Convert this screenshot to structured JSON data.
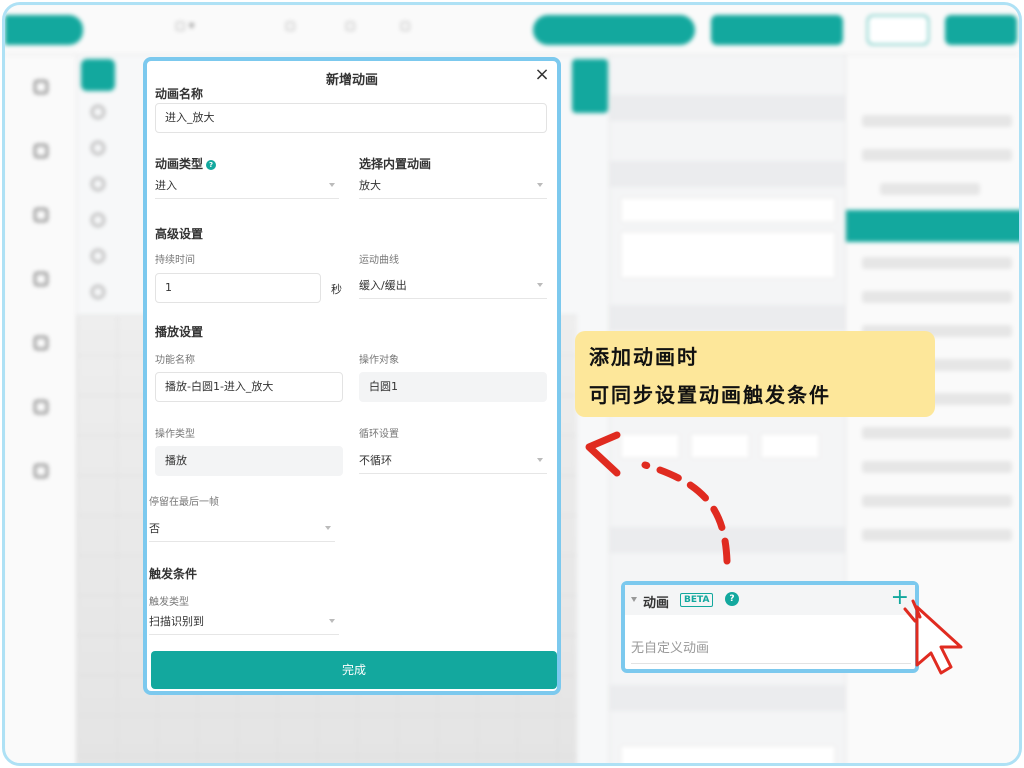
{
  "modal": {
    "title": "新增动画",
    "close_glyph": "×",
    "name_label": "动画名称",
    "name_value": "进入_放大",
    "type_label": "动画类型",
    "type_help": "?",
    "type_value": "进入",
    "builtin_label": "选择内置动画",
    "builtin_value": "放大",
    "advanced_label": "高级设置",
    "duration_label": "持续时间",
    "duration_value": "1",
    "duration_unit": "秒",
    "curve_label": "运动曲线",
    "curve_value": "缓入/缓出",
    "playback_label": "播放设置",
    "func_name_label": "功能名称",
    "func_name_value": "播放-白圆1-进入_放大",
    "target_label": "操作对象",
    "target_value": "白圆1",
    "op_type_label": "操作类型",
    "op_type_value": "播放",
    "loop_label": "循环设置",
    "loop_value": "不循环",
    "stay_label": "停留在最后一帧",
    "stay_value": "否",
    "trigger_label": "触发条件",
    "trigger_type_label": "触发类型",
    "trigger_type_value": "扫描识别到",
    "done_label": "完成"
  },
  "callout": {
    "line1": "添加动画时",
    "line2": "可同步设置动画触发条件"
  },
  "animation_card": {
    "title": "动画",
    "badge": "BETA",
    "help": "?",
    "add_glyph": "+",
    "empty_text": "无自定义动画"
  },
  "colors": {
    "accent": "#13a89e",
    "highlight_border": "#7cc9ee",
    "callout_bg": "#fde79a",
    "arrow": "#e02b20"
  },
  "icons": {
    "close": "close-icon",
    "help": "help-icon",
    "add": "plus-icon",
    "cursor": "hand-cursor-icon",
    "arrow": "curved-arrow-icon"
  }
}
